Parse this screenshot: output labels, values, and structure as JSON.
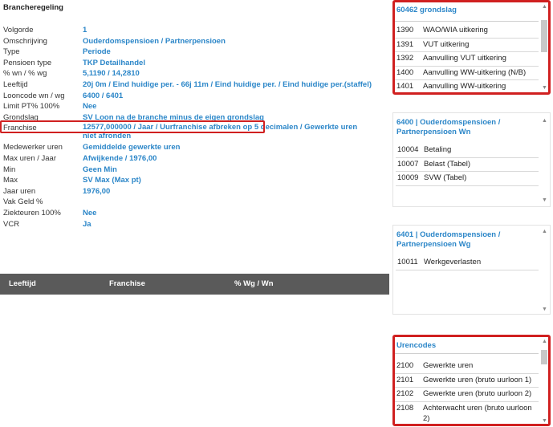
{
  "title": "Brancheregeling",
  "fields": [
    {
      "label": "Volgorde",
      "value": "1"
    },
    {
      "label": "Omschrijving",
      "value": "Ouderdomspensioen / Partnerpensioen"
    },
    {
      "label": "Type",
      "value": "Periode"
    },
    {
      "label": "Pensioen type",
      "value": "TKP Detailhandel"
    },
    {
      "label": "% wn / % wg",
      "value": "5,1190 / 14,2810"
    },
    {
      "label": "Leeftijd",
      "value": "20j 0m / Eind huidige per. - 66j 11m / Eind huidige per. / Eind huidige per.(staffel)"
    },
    {
      "label": "Looncode wn / wg",
      "value": "6400 / 6401"
    },
    {
      "label": "Limit PT% 100%",
      "value": "Nee"
    },
    {
      "label": "Grondslag",
      "value": "SV Loon na de branche minus de eigen grondslag"
    },
    {
      "label": "Franchise",
      "value": "12577,000000 / Jaar / Uurfranchise afbreken op 5 decimalen / Gewerkte uren niet afronden"
    },
    {
      "label": "Medewerker uren",
      "value": "Gemiddelde gewerkte uren"
    },
    {
      "label": "Max uren / Jaar",
      "value": "Afwijkende / 1976,00"
    },
    {
      "label": "Min",
      "value": "Geen Min"
    },
    {
      "label": "Max",
      "value": "SV Max (Max pt)"
    },
    {
      "label": "Jaar uren",
      "value": "1976,00"
    },
    {
      "label": "Vak Geld %",
      "value": ""
    },
    {
      "label": "Ziekteuren 100%",
      "value": "Nee"
    },
    {
      "label": "VCR",
      "value": "Ja"
    }
  ],
  "table_headers": [
    "Leeftijd",
    "Franchise",
    "% Wg / Wn"
  ],
  "panels": [
    {
      "title": "60462 grondslag",
      "items": [
        {
          "code": "1390",
          "name": "WAO/WIA uitkering"
        },
        {
          "code": "1391",
          "name": "VUT uitkering"
        },
        {
          "code": "1392",
          "name": "Aanvulling VUT uitkering"
        },
        {
          "code": "1400",
          "name": "Aanvulling WW-uitkering (N/B)"
        },
        {
          "code": "1401",
          "name": "Aanvulling WW-uitkering"
        }
      ]
    },
    {
      "title": "6400 | Ouderdomspensioen / Partnerpensioen Wn",
      "items": [
        {
          "code": "10004",
          "name": "Betaling"
        },
        {
          "code": "10007",
          "name": "Belast (Tabel)"
        },
        {
          "code": "10009",
          "name": "SVW (Tabel)"
        }
      ]
    },
    {
      "title": "6401 | Ouderdomspensioen / Partnerpensioen Wg",
      "items": [
        {
          "code": "10011",
          "name": "Werkgeverlasten"
        }
      ]
    },
    {
      "title": "Urencodes",
      "items": [
        {
          "code": "2100",
          "name": "Gewerkte uren"
        },
        {
          "code": "2101",
          "name": "Gewerkte uren (bruto uurloon 1)"
        },
        {
          "code": "2102",
          "name": "Gewerkte uren (bruto uurloon 2)"
        },
        {
          "code": "2108",
          "name": "Achterwacht uren (bruto uurloon 2)"
        }
      ]
    }
  ],
  "colors": {
    "link": "#2b86c8",
    "highlight": "#d02020",
    "table_header": "#5a5a5a"
  },
  "icons": {
    "scroll_up": "scroll-up-arrow-icon",
    "scroll_down": "scroll-down-arrow-icon"
  }
}
